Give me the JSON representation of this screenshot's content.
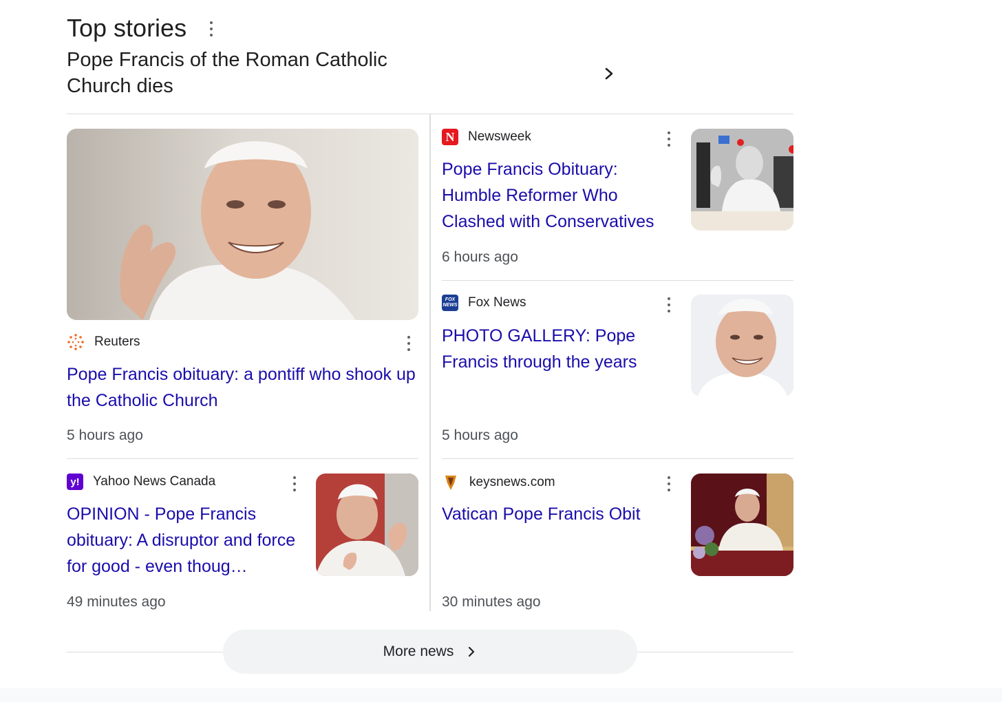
{
  "section": {
    "title": "Top stories"
  },
  "story": {
    "headline": "Pope Francis of the Roman Catholic Church dies"
  },
  "cards": {
    "reuters": {
      "source": "Reuters",
      "headline": "Pope Francis obituary: a pontiff who shook up the Catholic Church",
      "time": "5 hours ago"
    },
    "newsweek": {
      "source": "Newsweek",
      "logo_text": "N",
      "headline": "Pope Francis Obituary: Humble Reformer Who Clashed with Conservatives",
      "time": "6 hours ago"
    },
    "fox": {
      "source": "Fox News",
      "logo_text": "FOX NEWS",
      "headline": "PHOTO GALLERY: Pope Francis through the years",
      "time": "5 hours ago"
    },
    "yahoo": {
      "source": "Yahoo News Canada",
      "logo_text": "y!",
      "headline": "OPINION - Pope Francis obituary: A disruptor and force for good - even thoug…",
      "time": "49 minutes ago"
    },
    "keys": {
      "source": "keysnews.com",
      "headline": "Vatican Pope Francis Obit",
      "time": "30 minutes ago"
    }
  },
  "more": {
    "label": "More news"
  },
  "colors": {
    "link": "#1a0dab",
    "newsweek": "#e5191f",
    "yahoo": "#6001d2",
    "fox": "#1c3f94"
  }
}
